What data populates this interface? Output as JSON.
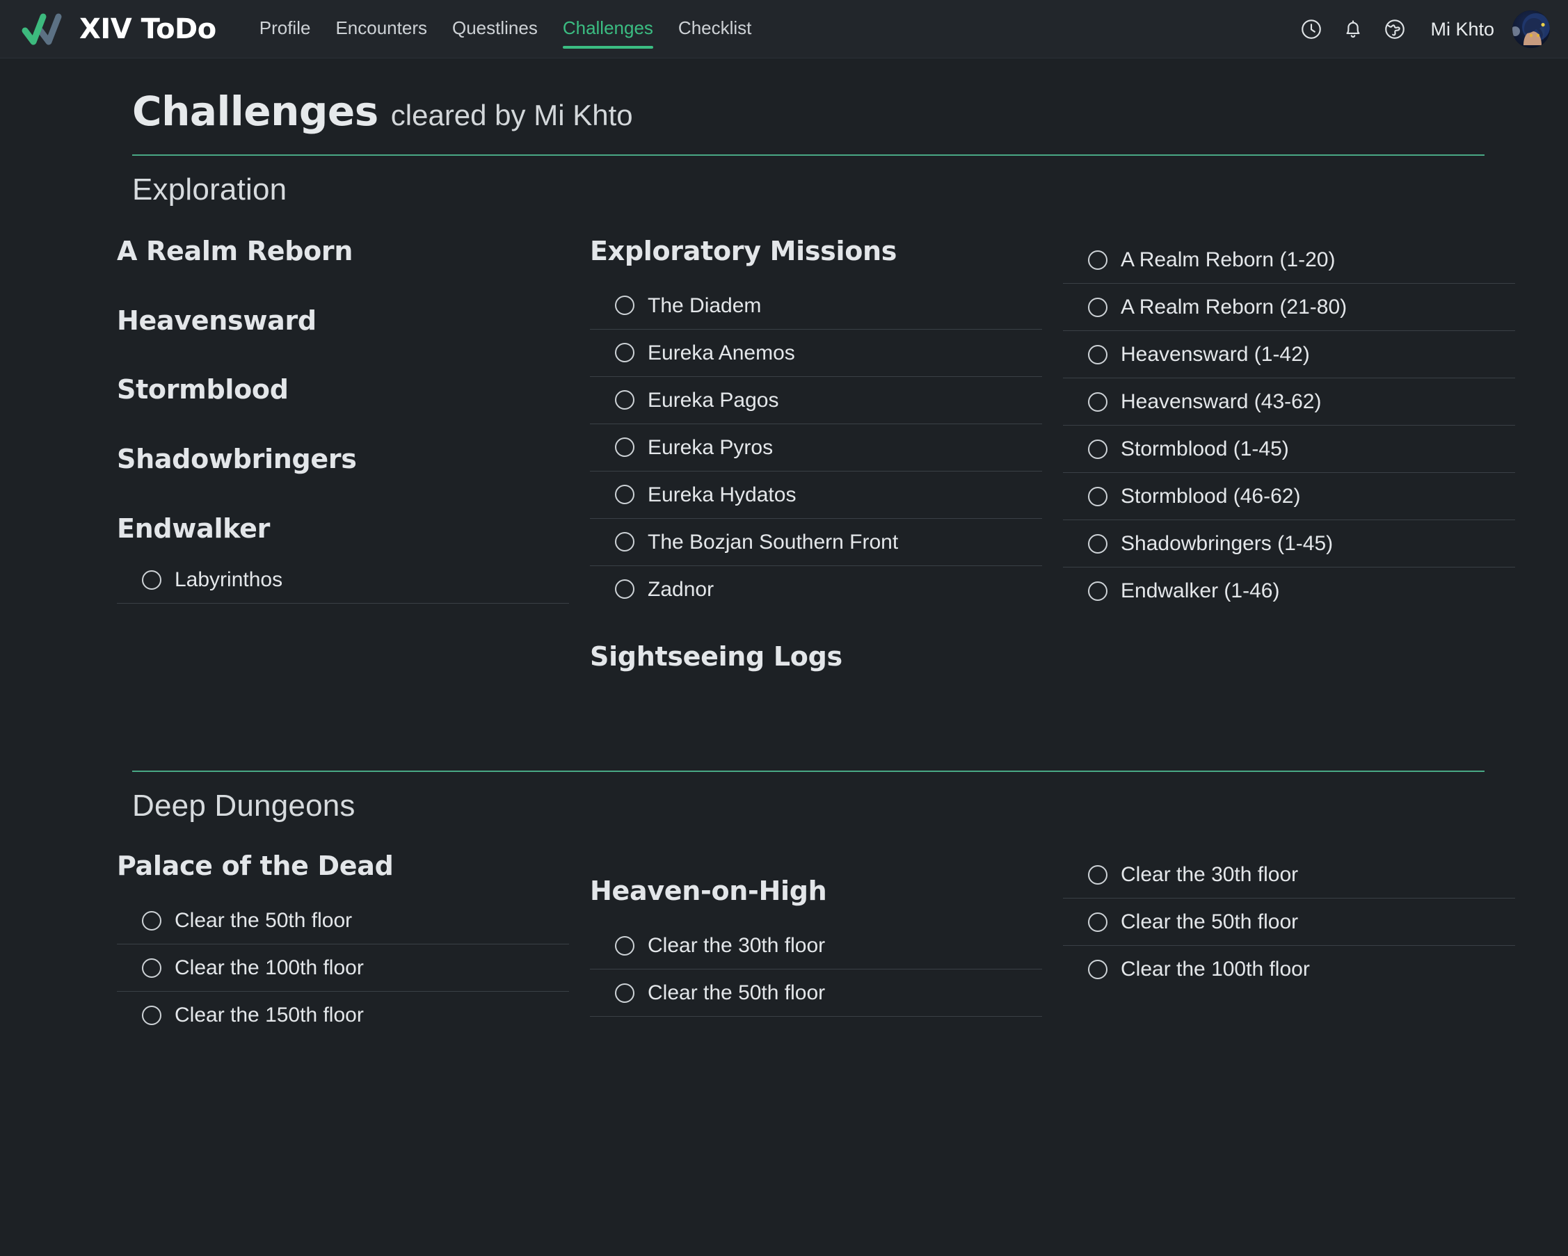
{
  "app": {
    "brand_text": "XIV ToDo",
    "logo_icon": "double-check-icon"
  },
  "nav": {
    "links": [
      {
        "label": "Profile",
        "active": false
      },
      {
        "label": "Encounters",
        "active": false
      },
      {
        "label": "Questlines",
        "active": false
      },
      {
        "label": "Challenges",
        "active": true
      },
      {
        "label": "Checklist",
        "active": false
      }
    ],
    "icons": [
      {
        "name": "clock-icon"
      },
      {
        "name": "bell-icon"
      },
      {
        "name": "globe-icon"
      }
    ],
    "user_name": "Mi Khto",
    "avatar": "user-avatar"
  },
  "header": {
    "title": "Challenges",
    "subtitle": "cleared by Mi Khto"
  },
  "sections": [
    {
      "label": "Exploration",
      "left": {
        "expansions": [
          "A Realm Reborn",
          "Heavensward",
          "Stormblood",
          "Shadowbringers",
          "Endwalker"
        ],
        "endwalker_items": [
          "Labyrinthos"
        ]
      },
      "middle": {
        "title": "Exploratory Missions",
        "items": [
          "The Diadem",
          "Eureka Anemos",
          "Eureka Pagos",
          "Eureka Pyros",
          "Eureka Hydatos",
          "The Bozjan Southern Front",
          "Zadnor"
        ],
        "second_title": "Sightseeing Logs"
      },
      "right": {
        "items": [
          "A Realm Reborn (1-20)",
          "A Realm Reborn (21-80)",
          "Heavensward (1-42)",
          "Heavensward (43-62)",
          "Stormblood (1-45)",
          "Stormblood (46-62)",
          "Shadowbringers (1-45)",
          "Endwalker (1-46)"
        ]
      }
    },
    {
      "label": "Deep Dungeons",
      "left": {
        "title": "Palace of the Dead",
        "items": [
          "Clear the 50th floor",
          "Clear the 100th floor",
          "Clear the 150th floor"
        ]
      },
      "middle": {
        "title": "Heaven-on-High",
        "items": [
          "Clear the 30th floor",
          "Clear the 50th floor"
        ]
      },
      "right": {
        "items": [
          "Clear the 30th floor",
          "Clear the 50th floor",
          "Clear the 100th floor"
        ]
      }
    }
  ],
  "colors": {
    "page_bg": "#1d2125",
    "nav_bg": "#22262b",
    "accent_green": "#3bbd82",
    "rule_green": "#49a885",
    "logo_green": "#3dba7e",
    "logo_slate": "#5c7184",
    "divider": "#3a4046",
    "text": "#e4e7ea"
  }
}
